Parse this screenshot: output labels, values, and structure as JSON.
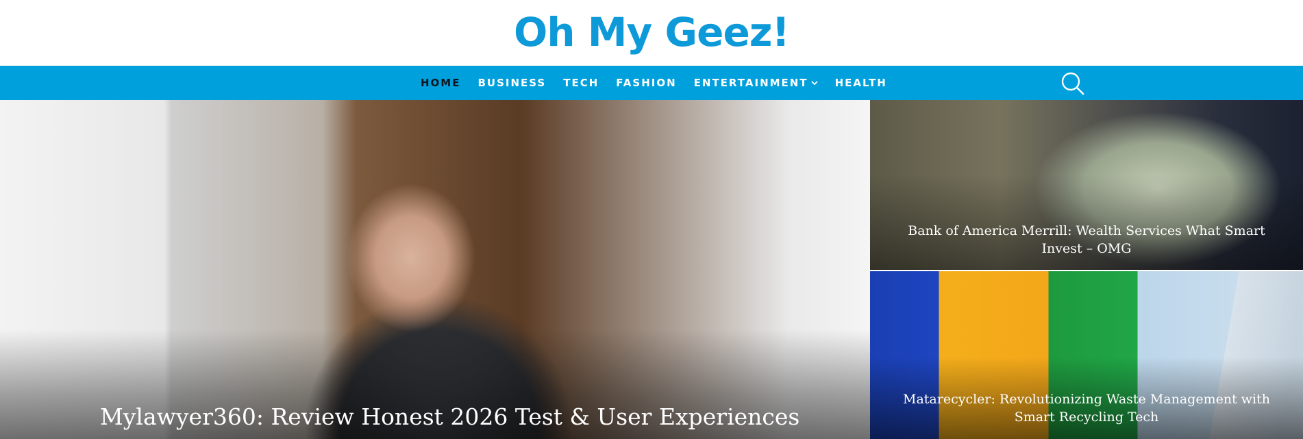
{
  "site": {
    "logo_text": "Oh My Geez!",
    "brand_color": "#0e9ad9",
    "nav_color": "#00a0dd"
  },
  "nav": {
    "items": [
      {
        "label": "HOME",
        "active": true
      },
      {
        "label": "BUSINESS"
      },
      {
        "label": "TECH"
      },
      {
        "label": "FASHION"
      },
      {
        "label": "ENTERTAINMENT",
        "has_dropdown": true
      },
      {
        "label": "HEALTH"
      }
    ],
    "search_icon": "search-icon"
  },
  "featured": {
    "main": {
      "title": "Mylawyer360: Review Honest 2026 Test & User Experiences",
      "image": "businessman in suit at desk with scales of justice"
    },
    "side": [
      {
        "title": "Bank of America Merrill: Wealth Services What Smart Invest – OMG",
        "image": "hands holding hundred dollar bills"
      },
      {
        "title": "Matarecycler: Revolutionizing Waste Management with Smart Recycling Tech",
        "image": "colorful recycling bins with hand holding cup"
      }
    ]
  }
}
